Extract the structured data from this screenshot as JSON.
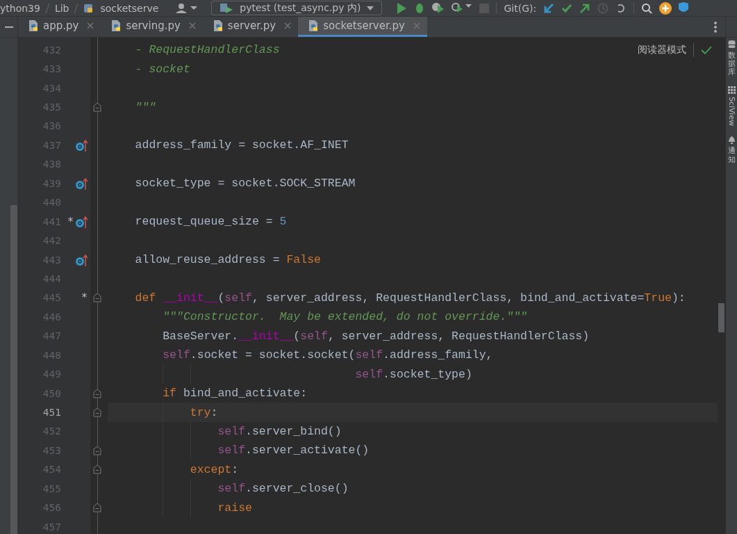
{
  "toolbar": {
    "breadcrumbs": [
      "ython39",
      "Lib",
      "socketserve"
    ],
    "run_config": "pytest (test_async.py 内)",
    "vcs_label": "Git(G):"
  },
  "tabs": [
    {
      "label": "app.py",
      "selected": false
    },
    {
      "label": "serving.py",
      "selected": false
    },
    {
      "label": "server.py",
      "selected": false
    },
    {
      "label": "socketserver.py",
      "selected": true
    }
  ],
  "reader_mode": "阅读器模式",
  "right_stripe": [
    {
      "kind": "database",
      "label": "数据库"
    },
    {
      "kind": "sciview",
      "label": "SciView"
    },
    {
      "kind": "notifications",
      "label": "通知"
    }
  ],
  "lines": [
    {
      "number": "432",
      "override": false,
      "fold": false,
      "current": false,
      "tokens": [
        {
          "kind": "doc",
          "text": "    - RequestHandlerClass"
        }
      ]
    },
    {
      "number": "433",
      "override": false,
      "fold": false,
      "current": false,
      "tokens": [
        {
          "kind": "doc",
          "text": "    - socket"
        }
      ]
    },
    {
      "number": "434",
      "override": false,
      "fold": false,
      "current": false
    },
    {
      "number": "435",
      "override": false,
      "fold": true,
      "current": false,
      "tokens": [
        {
          "kind": "doc",
          "text": "    \"\"\""
        }
      ]
    },
    {
      "number": "436",
      "override": false,
      "fold": false,
      "current": false
    },
    {
      "number": "437",
      "override": true,
      "fold": false,
      "current": false,
      "tokens": [
        {
          "kind": "plain",
          "text": "    address_family = socket.AF_INET"
        }
      ]
    },
    {
      "number": "438",
      "override": false,
      "fold": false,
      "current": false
    },
    {
      "number": "439",
      "override": true,
      "fold": false,
      "current": false,
      "tokens": [
        {
          "kind": "plain",
          "text": "    socket_type = socket.SOCK_STREAM"
        }
      ]
    },
    {
      "number": "440",
      "override": false,
      "fold": false,
      "current": false
    },
    {
      "number": "441",
      "mark": "*",
      "override": true,
      "fold": false,
      "current": false,
      "tokens": [
        {
          "kind": "plain",
          "text": "    request_queue_size = "
        },
        {
          "kind": "number",
          "text": "5"
        }
      ]
    },
    {
      "number": "442",
      "override": false,
      "fold": false,
      "current": false
    },
    {
      "number": "443",
      "override": true,
      "fold": false,
      "current": false,
      "tokens": [
        {
          "kind": "plain",
          "text": "    allow_reuse_address = "
        },
        {
          "kind": "keyword",
          "text": "False"
        }
      ]
    },
    {
      "number": "444",
      "override": false,
      "fold": false,
      "current": false
    },
    {
      "number": "445",
      "mark": "*",
      "override": false,
      "fold": true,
      "current": false,
      "tokens": [
        {
          "kind": "keyword",
          "text": "    def"
        },
        {
          "kind": "dunder",
          "text": " __init__"
        },
        {
          "kind": "plain",
          "text": "("
        },
        {
          "kind": "self",
          "text": "self"
        },
        {
          "kind": "plain",
          "text": ", server_address, RequestHandlerClass, bind_and_activate="
        },
        {
          "kind": "keyword",
          "text": "True"
        },
        {
          "kind": "plain",
          "text": "):"
        }
      ]
    },
    {
      "number": "446",
      "override": false,
      "fold": false,
      "current": false,
      "tokens": [
        {
          "kind": "doc",
          "text": "        \"\"\"Constructor.  May be extended, do not override.\"\"\""
        }
      ]
    },
    {
      "number": "447",
      "override": false,
      "fold": false,
      "current": false,
      "tokens": [
        {
          "kind": "plain",
          "text": "        BaseServer."
        },
        {
          "kind": "dunder",
          "text": "__init__"
        },
        {
          "kind": "plain",
          "text": "("
        },
        {
          "kind": "self",
          "text": "self"
        },
        {
          "kind": "plain",
          "text": ", server_address, RequestHandlerClass)"
        }
      ]
    },
    {
      "number": "448",
      "override": false,
      "fold": false,
      "current": false,
      "tokens": [
        {
          "kind": "self",
          "text": "        self"
        },
        {
          "kind": "plain",
          "text": ".socket = socket.socket("
        },
        {
          "kind": "self",
          "text": "self"
        },
        {
          "kind": "plain",
          "text": ".address_family,"
        }
      ]
    },
    {
      "number": "449",
      "override": false,
      "fold": false,
      "current": false,
      "tokens": [
        {
          "kind": "self",
          "text": "                                    self"
        },
        {
          "kind": "plain",
          "text": ".socket_type)"
        }
      ]
    },
    {
      "number": "450",
      "override": false,
      "fold": true,
      "current": false,
      "tokens": [
        {
          "kind": "keyword",
          "text": "        if"
        },
        {
          "kind": "plain",
          "text": " bind_and_activate:"
        }
      ]
    },
    {
      "number": "451",
      "override": false,
      "fold": true,
      "current": true,
      "tokens": [
        {
          "kind": "keyword",
          "text": "            try"
        },
        {
          "kind": "plain",
          "text": ":"
        }
      ]
    },
    {
      "number": "452",
      "override": false,
      "fold": false,
      "current": false,
      "tokens": [
        {
          "kind": "self",
          "text": "                self"
        },
        {
          "kind": "plain",
          "text": ".server_bind()"
        }
      ]
    },
    {
      "number": "453",
      "override": false,
      "fold": true,
      "current": false,
      "tokens": [
        {
          "kind": "self",
          "text": "                self"
        },
        {
          "kind": "plain",
          "text": ".server_activate()"
        }
      ]
    },
    {
      "number": "454",
      "override": false,
      "fold": true,
      "current": false,
      "tokens": [
        {
          "kind": "keyword",
          "text": "            except"
        },
        {
          "kind": "plain",
          "text": ":"
        }
      ]
    },
    {
      "number": "455",
      "override": false,
      "fold": false,
      "current": false,
      "tokens": [
        {
          "kind": "self",
          "text": "                self"
        },
        {
          "kind": "plain",
          "text": ".server_close()"
        }
      ]
    },
    {
      "number": "456",
      "override": false,
      "fold": true,
      "current": false,
      "tokens": [
        {
          "kind": "keyword",
          "text": "                raise"
        }
      ]
    },
    {
      "number": "457",
      "override": false,
      "fold": false,
      "current": false
    }
  ]
}
